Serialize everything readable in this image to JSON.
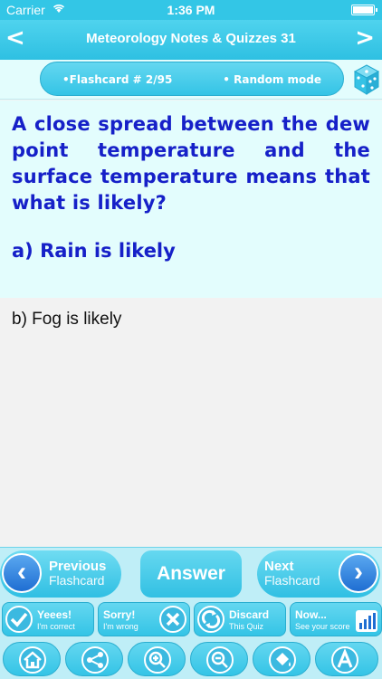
{
  "status": {
    "carrier": "Carrier",
    "time": "1:36 PM"
  },
  "nav": {
    "title": "Meteorology Notes & Quizzes 31",
    "back": "<",
    "forward": ">"
  },
  "info": {
    "flashcard": "•Flashcard # 2/95",
    "mode": "• Random mode"
  },
  "card": {
    "question": "A close spread between the dew point temperature and the surface temperature means that what is likely?",
    "option_a": "a) Rain is likely",
    "option_b": "b) Fog is likely"
  },
  "controls": {
    "previous": {
      "line1": "Previous",
      "line2": "Flashcard"
    },
    "answer": "Answer",
    "next": {
      "line1": "Next",
      "line2": "Flashcard"
    }
  },
  "actions": [
    {
      "line1": "Yeees!",
      "line2": "I'm correct"
    },
    {
      "line1": "Sorry!",
      "line2": "I'm wrong"
    },
    {
      "line1": "Discard",
      "line2": "This Quiz"
    },
    {
      "line1": "Now...",
      "line2": "See your score"
    }
  ],
  "toolbar_icons": [
    "home-icon",
    "share-icon",
    "zoom-in-icon",
    "zoom-out-icon",
    "paint-bucket-icon",
    "font-icon"
  ],
  "colors": {
    "accent": "#33c6e6",
    "question_text": "#1620c8",
    "card_bg": "#e3fdfd"
  }
}
